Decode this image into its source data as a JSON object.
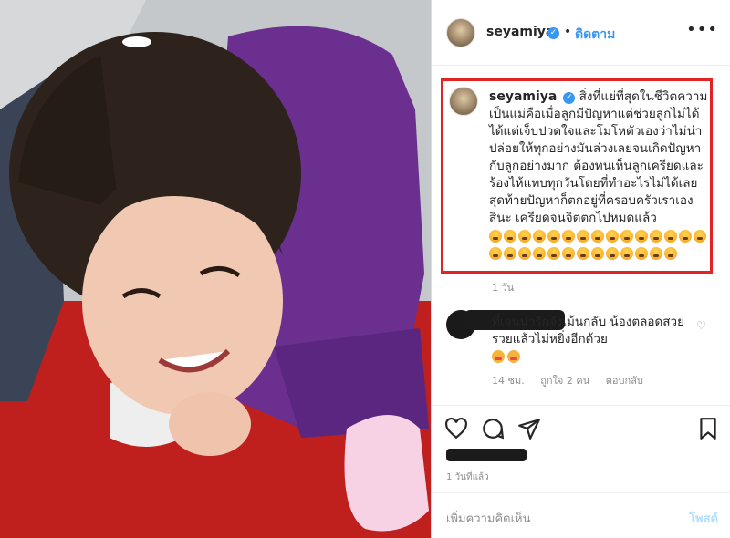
{
  "header": {
    "username": "seyamiya",
    "separator": "•",
    "follow_label": "ติดตาม",
    "more_icon": "more-horizontal-icon"
  },
  "caption": {
    "username": "seyamiya",
    "text": "สิ่งที่แย่ที่สุดในชีวิตความเป็นแม่คือเมื่อลูกมีปัญหาแต่ช่วยลูกไม่ได้ ได้แต่เจ็บปวดใจและโมโหตัวเองว่าไม่น่าปล่อยให้ทุกอย่างมันล่วงเลยจนเกิดปัญหากับลูกอย่างมาก ต้องทนเห็นลูกเครียดและร้องไห้แทบทุกวันโดยที่ทำอะไรไม่ได้เลย สุดท้ายปัญหาก็ตกอยู่ที่ครอบครัวเราเองสินะ เครียดจนจิตตกไปหมดแล้ว",
    "emoji_name": "loudly-crying-face",
    "emoji_count": 28,
    "time": "1 วัน"
  },
  "comment": {
    "text": "ที่เจนน่ารักจังเม้นกลับ น้องตลอดสวยรวยแล้วไม่หยิ่งอีกด้วย",
    "emoji_count": 2,
    "time": "14 ชม.",
    "likes": "ถูกใจ 2 คน",
    "reply_label": "ตอบกลับ"
  },
  "actions": {
    "icons": [
      "heart-icon",
      "comment-icon",
      "share-icon",
      "bookmark-icon"
    ]
  },
  "post": {
    "time": "1 วันที่แล้ว"
  },
  "add_comment": {
    "placeholder": "เพิ่มความคิดเห็น",
    "post_label": "โพสต์"
  },
  "colors": {
    "accent": "#3897f0",
    "highlight_border": "#e02424",
    "muted": "#8e8e8e"
  }
}
